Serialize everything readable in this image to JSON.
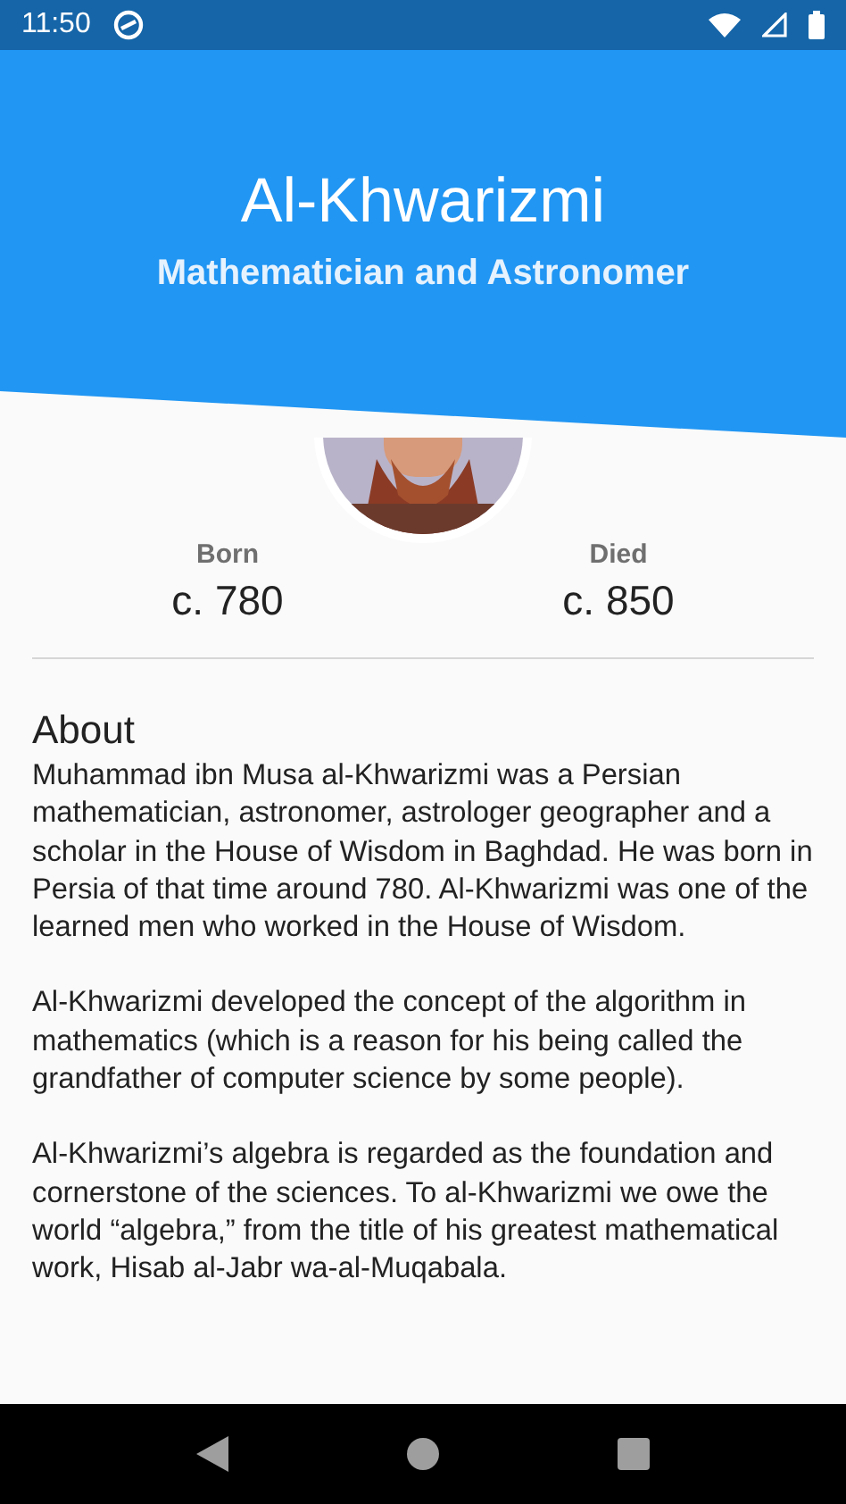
{
  "status_bar": {
    "time": "11:50"
  },
  "header": {
    "title": "Al-Khwarizmi",
    "subtitle": "Mathematician and Astronomer"
  },
  "facts": [
    {
      "label": "Born",
      "value": "c. 780"
    },
    {
      "label": "Died",
      "value": "c. 850"
    }
  ],
  "about": {
    "heading": "About",
    "paragraphs": [
      "Muhammad ibn Musa al-Khwarizmi was a Persian mathematician, astronomer, astrologer geographer and a scholar in the House of Wisdom in Baghdad. He was born in Persia of that time around 780. Al-Khwarizmi was one of the learned men who worked in the House of Wisdom.",
      "Al-Khwarizmi developed the concept of the algorithm in mathematics (which is a reason for his being called the grandfather of computer science by some people).",
      "Al-Khwarizmi’s algebra is regarded as the foundation and cornerstone of the sciences. To al-Khwarizmi we owe the world “algebra,” from the title of his greatest mathematical work, Hisab al-Jabr wa-al-Muqabala."
    ]
  }
}
